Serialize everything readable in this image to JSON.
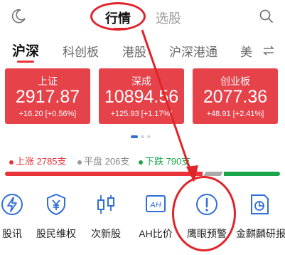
{
  "top_tabs": [
    {
      "label": "行情",
      "active": true
    },
    {
      "label": "选股",
      "active": false
    }
  ],
  "market_tabs": [
    {
      "label": "沪深",
      "active": true
    },
    {
      "label": "科创板",
      "active": false
    },
    {
      "label": "港股",
      "active": false
    },
    {
      "label": "沪深港通",
      "active": false
    },
    {
      "label": "美",
      "active": false
    }
  ],
  "indices": [
    {
      "name": "上证",
      "value": "2917.87",
      "change": "+16.20 [+0.56%]"
    },
    {
      "name": "深成",
      "value": "10894.56",
      "change": "+125.93 [+1.17%]"
    },
    {
      "name": "创业板",
      "value": "2077.36",
      "change": "+48.91 [+2.41%]"
    }
  ],
  "breadth": {
    "up": "上涨 2785支",
    "flat": "平盘 206支",
    "down": "下跌 790支",
    "up_share": 0.73,
    "flat_share": 0.06,
    "down_share": 0.21
  },
  "shortcuts": [
    {
      "label": "股讯",
      "icon": "lightning-icon"
    },
    {
      "label": "股民维权",
      "icon": "yen-shield-icon"
    },
    {
      "label": "次新股",
      "icon": "candlestick-icon"
    },
    {
      "label": "AH比价",
      "icon": "ah-icon"
    },
    {
      "label": "鹰眼预警",
      "icon": "alert-circle-icon"
    },
    {
      "label": "金麒麟研报",
      "icon": "report-chart-icon"
    }
  ],
  "colors": {
    "accent": "#e8333a",
    "card": "#e5424a",
    "up": "#e8333a",
    "flat": "#999999",
    "down": "#1aa64a",
    "icon": "#2f6fd6",
    "annotation": "#e0242a"
  }
}
